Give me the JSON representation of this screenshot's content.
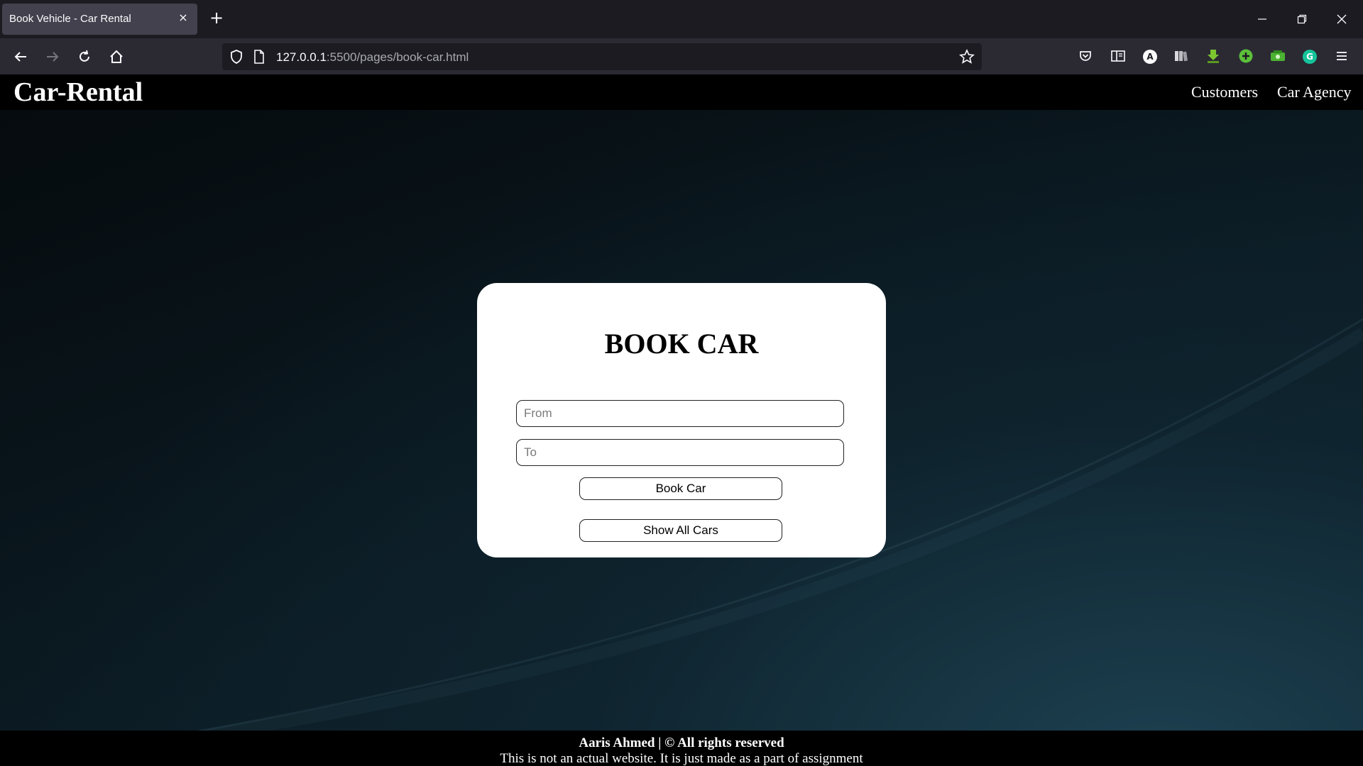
{
  "browser": {
    "tab_title": "Book Vehicle - Car Rental",
    "tab_close": "×",
    "new_tab": "+",
    "url_host": "127.0.0.1",
    "url_rest": ":5500/pages/book-car.html",
    "extension_a_label": "A",
    "extension_g_label": "G"
  },
  "site": {
    "brand": "Car-Rental",
    "nav": [
      "Customers",
      "Car Agency"
    ]
  },
  "form": {
    "title": "BOOK CAR",
    "from_placeholder": "From",
    "to_placeholder": "To",
    "book_button": "Book Car",
    "show_button": "Show All Cars"
  },
  "footer": {
    "line1": "Aaris Ahmed | © All rights reserved",
    "line2": "This is not an actual website. It is just made as a part of assignment"
  },
  "colors": {
    "chrome_dark": "#1c1b22",
    "chrome_toolbar": "#2b2a33",
    "active_tab": "#42414d",
    "header_bg": "#000000",
    "card_bg": "#ffffff"
  }
}
